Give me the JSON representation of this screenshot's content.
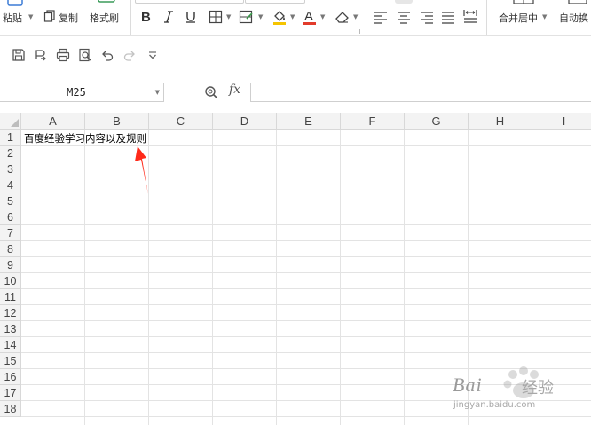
{
  "ribbon": {
    "paste_label": "粘贴",
    "copy_label": "复制",
    "format_painter_label": "格式刷",
    "merge_center_label": "合并居中",
    "auto_wrap_label": "自动换"
  },
  "name_box": {
    "value": "M25"
  },
  "formula_bar": {
    "fx_label": "fx",
    "value": ""
  },
  "grid": {
    "columns": [
      "A",
      "B",
      "C",
      "D",
      "E",
      "F",
      "G",
      "H",
      "I"
    ],
    "rows": [
      "1",
      "2",
      "3",
      "4",
      "5",
      "6",
      "7",
      "8",
      "9",
      "10",
      "11",
      "12",
      "13",
      "14",
      "15",
      "16",
      "17",
      "18"
    ]
  },
  "cells": {
    "A1": "百度经验学习内容以及规则"
  },
  "watermark": {
    "brand": "Bai",
    "brand_cn": "经验",
    "url": "jingyan.baidu.com"
  },
  "colors": {
    "arrow": "#ff2a1a",
    "font_color_underline": "#e23b2b",
    "fill_color_underline": "#f5c400"
  }
}
